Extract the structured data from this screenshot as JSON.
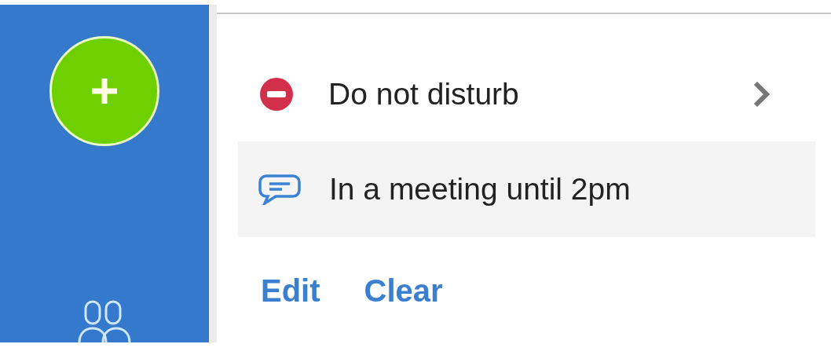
{
  "status": {
    "label": "Do not disturb"
  },
  "message": {
    "text": "In a meeting until 2pm"
  },
  "actions": [
    {
      "label": "Edit"
    },
    {
      "label": "Clear"
    }
  ]
}
